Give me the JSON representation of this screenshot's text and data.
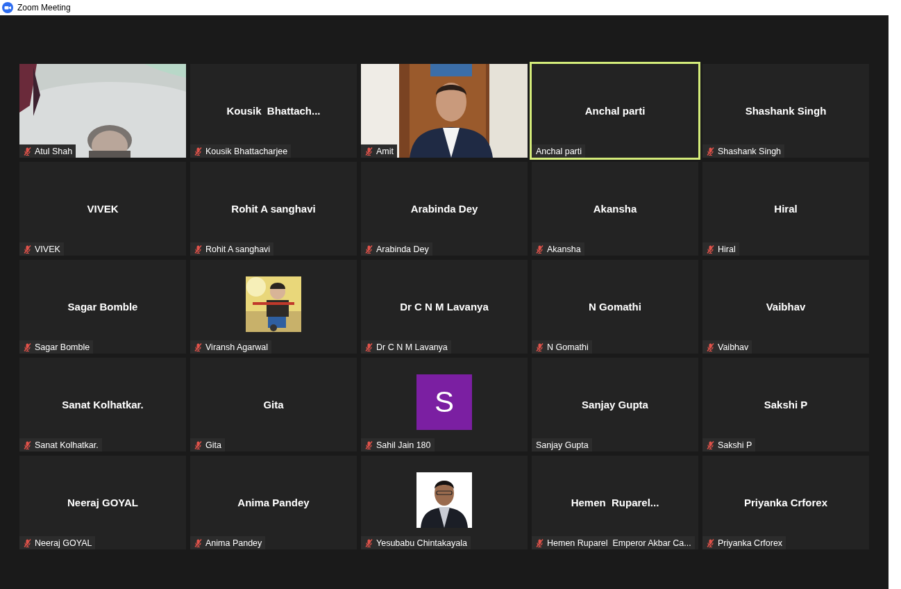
{
  "window": {
    "title": "Zoom Meeting"
  },
  "tiles": [
    {
      "kind": "video",
      "label": "Atul Shah",
      "muted": true,
      "speaking": false
    },
    {
      "kind": "name",
      "display": "Kousik  Bhattach...",
      "label": "Kousik Bhattacharjee",
      "muted": true,
      "speaking": false
    },
    {
      "kind": "video",
      "label": "Amit",
      "muted": true,
      "speaking": false
    },
    {
      "kind": "name",
      "display": "Anchal parti",
      "label": "Anchal parti",
      "muted": false,
      "speaking": true
    },
    {
      "kind": "name",
      "display": "Shashank Singh",
      "label": "Shashank Singh",
      "muted": true,
      "speaking": false
    },
    {
      "kind": "name",
      "display": "VIVEK",
      "label": "VIVEK",
      "muted": true,
      "speaking": false
    },
    {
      "kind": "name",
      "display": "Rohit A sanghavi",
      "label": "Rohit A sanghavi",
      "muted": true,
      "speaking": false
    },
    {
      "kind": "name",
      "display": "Arabinda Dey",
      "label": "Arabinda Dey",
      "muted": true,
      "speaking": false
    },
    {
      "kind": "name",
      "display": "Akansha",
      "label": "Akansha",
      "muted": true,
      "speaking": false
    },
    {
      "kind": "name",
      "display": "Hiral",
      "label": "Hiral",
      "muted": true,
      "speaking": false
    },
    {
      "kind": "name",
      "display": "Sagar Bomble",
      "label": "Sagar Bomble",
      "muted": true,
      "speaking": false
    },
    {
      "label": "Viransh Agarwal",
      "muted": true,
      "speaking": false
    },
    {
      "kind": "name",
      "display": "Dr C N M Lavanya",
      "label": "Dr C N M Lavanya",
      "muted": true,
      "speaking": false
    },
    {
      "kind": "name",
      "display": "N Gomathi",
      "label": "N Gomathi",
      "muted": true,
      "speaking": false
    },
    {
      "kind": "name",
      "display": "Vaibhav",
      "label": "Vaibhav",
      "muted": true,
      "speaking": false
    },
    {
      "kind": "name",
      "display": "Sanat Kolhatkar.",
      "label": "Sanat Kolhatkar.",
      "muted": true,
      "speaking": false
    },
    {
      "kind": "name",
      "display": "Gita",
      "label": "Gita",
      "muted": true,
      "speaking": false
    },
    {
      "kind": "letter",
      "letter": "S",
      "label": "Sahil Jain 180",
      "muted": true,
      "speaking": false
    },
    {
      "kind": "name",
      "display": "Sanjay Gupta",
      "label": "Sanjay Gupta",
      "muted": false,
      "speaking": false
    },
    {
      "kind": "name",
      "display": "Sakshi P",
      "label": "Sakshi P",
      "muted": true,
      "speaking": false
    },
    {
      "kind": "name",
      "display": "Neeraj GOYAL",
      "label": "Neeraj GOYAL",
      "muted": true,
      "speaking": false
    },
    {
      "kind": "name",
      "display": "Anima Pandey",
      "label": "Anima Pandey",
      "muted": true,
      "speaking": false
    },
    {
      "label": "Yesubabu Chintakayala",
      "muted": true,
      "speaking": false
    },
    {
      "kind": "name",
      "display": "Hemen  Ruparel...",
      "label": "Hemen Ruparel  Emperor Akbar Ca...",
      "muted": true,
      "speaking": false
    },
    {
      "kind": "name",
      "display": "Priyanka Crforex",
      "label": "Priyanka Crforex",
      "muted": true,
      "speaking": false
    }
  ]
}
